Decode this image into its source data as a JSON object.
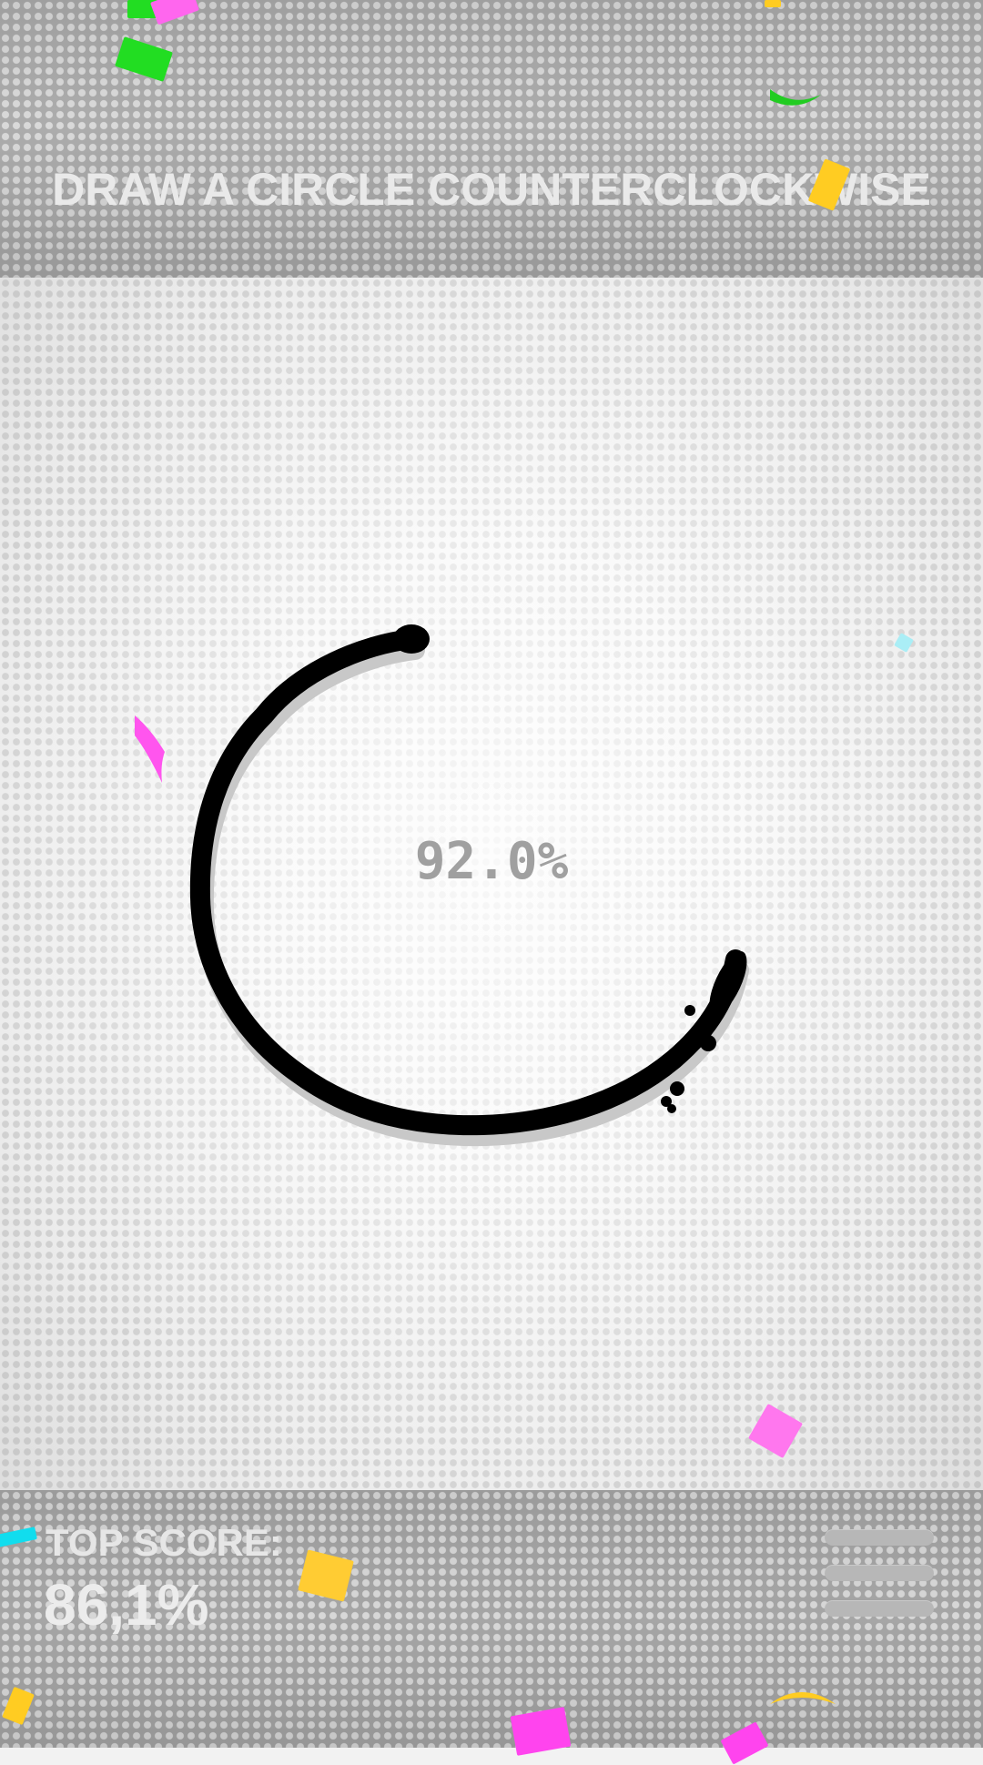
{
  "header": {
    "instruction": "DRAW A CIRCLE COUNTERCLOCKWISE"
  },
  "canvas": {
    "score_percent": "92.0%",
    "stroke_color": "#000000"
  },
  "footer": {
    "top_score_label": "TOP SCORE:",
    "top_score_value": "86,1%",
    "menu_icon": "hamburger-menu-icon"
  },
  "colors": {
    "bar_gray": "#a9a9a9",
    "canvas_bg": "#f4f4f4",
    "confetti": [
      "#ff55ee",
      "#22dd22",
      "#ffcc22",
      "#11ddee"
    ]
  }
}
